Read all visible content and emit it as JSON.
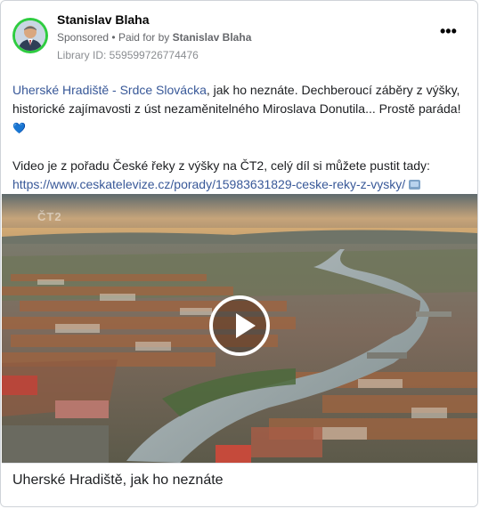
{
  "advertiser": {
    "name": "Stanislav Blaha",
    "sponsored_label": "Sponsored",
    "separator": "•",
    "paid_prefix": "Paid for by",
    "paid_by": "Stanislav Blaha",
    "library_id": "Library ID: 559599726774476"
  },
  "post": {
    "link_place": "Uherské Hradiště - Srdce Slovácka",
    "line1_rest": ", jak ho neznáte. Dechberoucí záběry z výšky,",
    "line2": "historické zajímavosti z úst nezaměnitelného Miroslava Donutila... Prostě paráda!",
    "heart_emoji": "💙",
    "line4": "Video je z pořadu České řeky z výšky na ČT2, celý díl si můžete pustit tady:",
    "url": "https://www.ceskatelevize.cz/porady/15983631829-ceske-reky-z-vysky/",
    "tv_icon": "tv-icon"
  },
  "media": {
    "watermark": "ČT2",
    "play_icon": "play-icon"
  },
  "caption": "Uherské Hradiště, jak ho neznáte",
  "colors": {
    "link": "#385898",
    "avatar_ring": "#2ecc40",
    "muted": "#65676b"
  }
}
